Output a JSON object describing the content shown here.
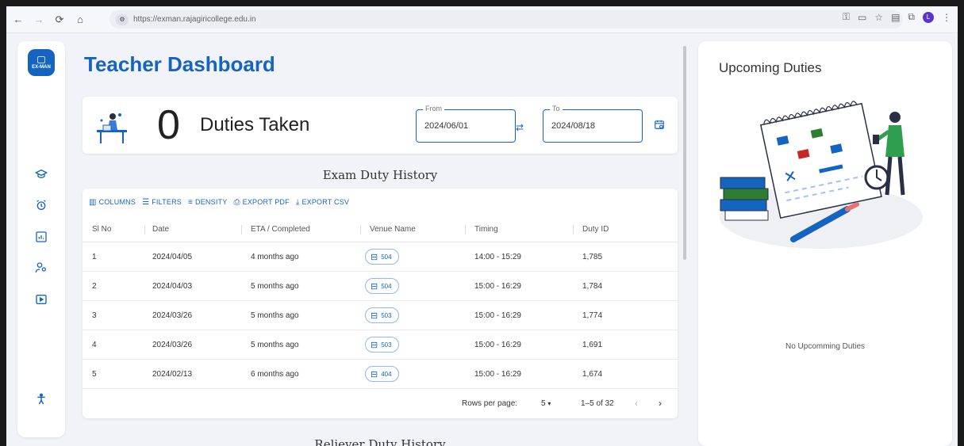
{
  "browser": {
    "url": "https://exman.rajagiricollege.edu.in",
    "profile_initial": "L"
  },
  "sidebar": {
    "logo_text": "EX-MAN",
    "items": [
      {
        "icon": "graduation-cap-icon"
      },
      {
        "icon": "alarm-icon"
      },
      {
        "icon": "bar-chart-icon"
      },
      {
        "icon": "people-icon"
      },
      {
        "icon": "play-icon"
      }
    ],
    "footer_icon": "accessibility-icon"
  },
  "main": {
    "title": "Teacher Dashboard",
    "duty_count": "0",
    "duty_label": "Duties Taken",
    "from_label": "From",
    "from_value": "2024/06/01",
    "to_label": "To",
    "to_value": "2024/08/18",
    "history_title": "Exam Duty History",
    "reliever_title": "Reliever Duty History",
    "toolbar": {
      "columns": "COLUMNS",
      "filters": "FILTERS",
      "density": "DENSITY",
      "export_pdf": "EXPORT PDF",
      "export_csv": "EXPORT CSV"
    },
    "table": {
      "headers": [
        "Sl No",
        "Date",
        "ETA / Completed",
        "Venue Name",
        "Timing",
        "Duty ID"
      ],
      "rows": [
        {
          "sl": "1",
          "date": "2024/04/05",
          "eta": "4 months ago",
          "venue": "504",
          "timing": "14:00 - 15:29",
          "duty_id": "1,785"
        },
        {
          "sl": "2",
          "date": "2024/04/03",
          "eta": "5 months ago",
          "venue": "504",
          "timing": "15:00 - 16:29",
          "duty_id": "1,784"
        },
        {
          "sl": "3",
          "date": "2024/03/26",
          "eta": "5 months ago",
          "venue": "503",
          "timing": "15:00 - 16:29",
          "duty_id": "1,774"
        },
        {
          "sl": "4",
          "date": "2024/03/26",
          "eta": "5 months ago",
          "venue": "503",
          "timing": "15:00 - 16:29",
          "duty_id": "1,691"
        },
        {
          "sl": "5",
          "date": "2024/02/13",
          "eta": "6 months ago",
          "venue": "404",
          "timing": "15:00 - 16:29",
          "duty_id": "1,674"
        }
      ]
    },
    "footer": {
      "rows_per_page_label": "Rows per page:",
      "rows_per_page_value": "5",
      "range": "1–5 of 32"
    }
  },
  "right_panel": {
    "title": "Upcoming Duties",
    "empty_text": "No Upcomming Duties"
  },
  "colors": {
    "primary": "#1565c0",
    "background": "#f1f3f8"
  }
}
